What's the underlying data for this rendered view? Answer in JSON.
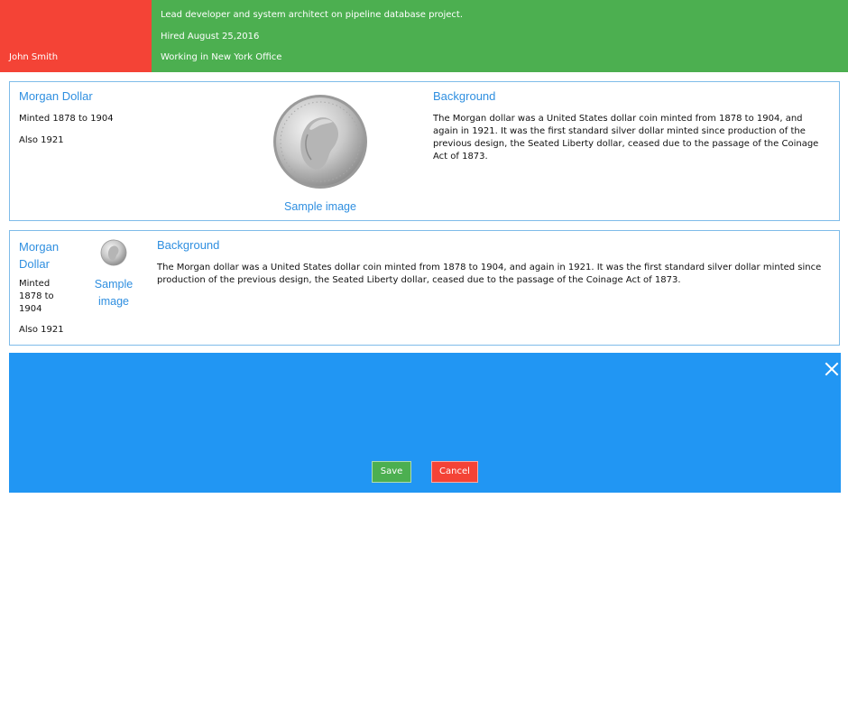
{
  "header": {
    "name": "John Smith",
    "line1": "Lead developer and system architect on pipeline database project.",
    "line2": "Hired August 25,2016",
    "line3": "Working in New York Office",
    "colors": {
      "name_bg": "#f44336",
      "info_bg": "#4caf50"
    }
  },
  "card1": {
    "title": "Morgan Dollar",
    "minted": "Minted 1878 to 1904",
    "also": "Also 1921",
    "image_caption": "Sample image",
    "bg_title": "Background",
    "bg_text": "The Morgan dollar was a United States dollar coin minted from 1878 to 1904, and again in 1921. It was the first standard silver dollar minted since production of the previous design, the Seated Liberty dollar, ceased due to the passage of the Coinage Act of 1873."
  },
  "card2": {
    "title": "Morgan Dollar",
    "minted": "Minted 1878 to 1904",
    "also": "Also 1921",
    "image_caption": "Sample image",
    "bg_title": "Background",
    "bg_text": "The Morgan dollar was a United States dollar coin minted from 1878 to 1904, and again in 1921. It was the first standard silver dollar minted since production of the previous design, the Seated Liberty dollar, ceased due to the passage of the Coinage Act of 1873."
  },
  "panel": {
    "save_label": "Save",
    "cancel_label": "Cancel",
    "colors": {
      "panel_bg": "#2196f3",
      "save_bg": "#4caf50",
      "cancel_bg": "#f44336",
      "accent": "#2f8fe0"
    }
  },
  "icons": {
    "close": "close-icon",
    "coin": "coin-image"
  }
}
